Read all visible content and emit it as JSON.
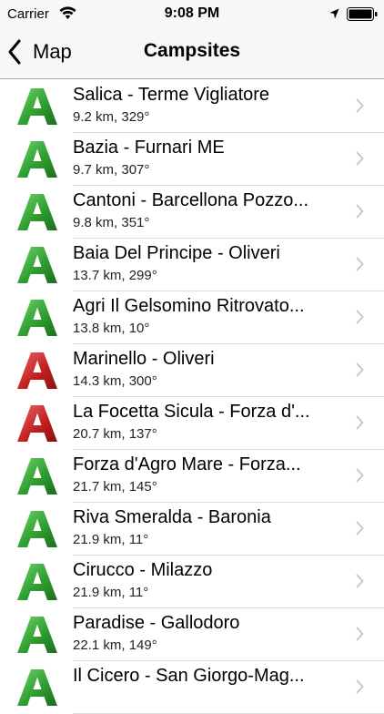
{
  "status_bar": {
    "carrier": "Carrier",
    "time": "9:08 PM"
  },
  "nav": {
    "back_label": "Map",
    "title": "Campsites"
  },
  "colors": {
    "green_marker": "#2e9e2e",
    "red_marker": "#c42020",
    "chevron": "#c7c7cc"
  },
  "campsites": [
    {
      "name": "Salica - Terme Vigliatore",
      "detail": "9.2 km, 329°",
      "marker": "green"
    },
    {
      "name": "Bazia - Furnari ME",
      "detail": "9.7 km, 307°",
      "marker": "green"
    },
    {
      "name": "Cantoni - Barcellona Pozzo...",
      "detail": "9.8 km, 351°",
      "marker": "green"
    },
    {
      "name": "Baia Del Principe - Oliveri",
      "detail": "13.7 km, 299°",
      "marker": "green"
    },
    {
      "name": "Agri Il Gelsomino Ritrovato...",
      "detail": "13.8 km, 10°",
      "marker": "green"
    },
    {
      "name": "Marinello - Oliveri",
      "detail": "14.3 km, 300°",
      "marker": "red"
    },
    {
      "name": "La Focetta Sicula - Forza d'...",
      "detail": "20.7 km, 137°",
      "marker": "red"
    },
    {
      "name": "Forza d'Agro Mare - Forza...",
      "detail": "21.7 km, 145°",
      "marker": "green"
    },
    {
      "name": "Riva Smeralda - Baronia",
      "detail": "21.9 km, 11°",
      "marker": "green"
    },
    {
      "name": "Cirucco - Milazzo",
      "detail": "21.9 km, 11°",
      "marker": "green"
    },
    {
      "name": "Paradise - Gallodoro",
      "detail": "22.1 km, 149°",
      "marker": "green"
    },
    {
      "name": "Il Cicero - San Giorgo-Mag...",
      "detail": "",
      "marker": "green"
    }
  ]
}
